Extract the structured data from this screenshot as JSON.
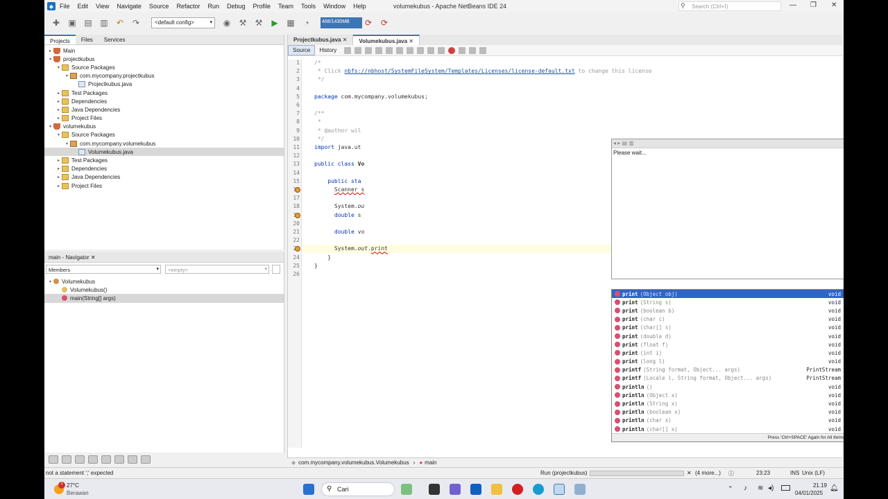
{
  "titlebar": {
    "title": "volumekubus - Apache NetBeans IDE 24",
    "search_placeholder": "Search (Ctrl+I)"
  },
  "menu": [
    "File",
    "Edit",
    "View",
    "Navigate",
    "Source",
    "Refactor",
    "Run",
    "Debug",
    "Profile",
    "Team",
    "Tools",
    "Window",
    "Help"
  ],
  "toolbar": {
    "config": "<default config>",
    "memory": "468/1430MB"
  },
  "projects": {
    "tabs": [
      "Projects",
      "Files",
      "Services"
    ],
    "tree": [
      {
        "label": "Main",
        "indent": 0,
        "icon": "cup",
        "toggle": "▸"
      },
      {
        "label": "projectkubus",
        "indent": 0,
        "icon": "cup",
        "toggle": "▾"
      },
      {
        "label": "Source Packages",
        "indent": 1,
        "icon": "fold",
        "toggle": "▾"
      },
      {
        "label": "com.mycompany.projectkubus",
        "indent": 2,
        "icon": "pkg",
        "toggle": "▾"
      },
      {
        "label": "Projectkubus.java",
        "indent": 3,
        "icon": "javaf",
        "toggle": ""
      },
      {
        "label": "Test Packages",
        "indent": 1,
        "icon": "fold",
        "toggle": "▸"
      },
      {
        "label": "Dependencies",
        "indent": 1,
        "icon": "fold",
        "toggle": "▸"
      },
      {
        "label": "Java Dependencies",
        "indent": 1,
        "icon": "fold",
        "toggle": "▸"
      },
      {
        "label": "Project Files",
        "indent": 1,
        "icon": "fold",
        "toggle": "▸"
      },
      {
        "label": "volumekubus",
        "indent": 0,
        "icon": "cup",
        "toggle": "▾"
      },
      {
        "label": "Source Packages",
        "indent": 1,
        "icon": "fold",
        "toggle": "▾"
      },
      {
        "label": "com.mycompany.volumekubus",
        "indent": 2,
        "icon": "pkg",
        "toggle": "▾"
      },
      {
        "label": "Volumekubus.java",
        "indent": 3,
        "icon": "javaf",
        "toggle": "",
        "selected": true
      },
      {
        "label": "Test Packages",
        "indent": 1,
        "icon": "fold",
        "toggle": "▸"
      },
      {
        "label": "Dependencies",
        "indent": 1,
        "icon": "fold",
        "toggle": "▸"
      },
      {
        "label": "Java Dependencies",
        "indent": 1,
        "icon": "fold",
        "toggle": "▸"
      },
      {
        "label": "Project Files",
        "indent": 1,
        "icon": "fold",
        "toggle": "▸"
      }
    ]
  },
  "navigator": {
    "title": "main - Navigator",
    "members": "Members",
    "empty": "<empty>",
    "tree": [
      {
        "label": "Volumekubus",
        "indent": 0,
        "toggle": "▾"
      },
      {
        "label": "Volumekubus()",
        "indent": 1,
        "toggle": ""
      },
      {
        "label": "main(String[] args)",
        "indent": 1,
        "toggle": "",
        "selected": true
      }
    ]
  },
  "editor": {
    "tabs": [
      "Projectkubus.java",
      "Volumekubus.java"
    ],
    "source": "Source",
    "history": "History",
    "lines": [
      {
        "n": "1",
        "html": "<span class='cmt'>/*</span>"
      },
      {
        "n": "2",
        "html": "<span class='cmt'> * Click </span><span class='lnk'>nbfs://nbhost/SystemFileSystem/Templates/Licenses/license-default.txt</span><span class='cmt'> to change this license</span>"
      },
      {
        "n": "3",
        "html": "<span class='cmt'> */</span>"
      },
      {
        "n": "4",
        "html": ""
      },
      {
        "n": "5",
        "html": "<span class='kw'>package</span> com.mycompany.volumekubus;"
      },
      {
        "n": "6",
        "html": ""
      },
      {
        "n": "7",
        "html": "<span class='cmt'>/**</span>"
      },
      {
        "n": "8",
        "html": "<span class='cmt'> *</span>"
      },
      {
        "n": "9",
        "html": "<span class='cmt'> * @author wil</span>"
      },
      {
        "n": "10",
        "html": "<span class='cmt'> */</span>"
      },
      {
        "n": "11",
        "html": "<span class='kw'>import</span> java.ut"
      },
      {
        "n": "12",
        "html": ""
      },
      {
        "n": "13",
        "html": "<span class='kw'>public class</span> <b>Vo</b>"
      },
      {
        "n": "14",
        "html": ""
      },
      {
        "n": "15",
        "html": "    <span class='kw'>public sta</span>"
      },
      {
        "n": "16",
        "html": "      <span style='text-decoration:underline wavy #d00'>Scanner s</span>"
      },
      {
        "n": "17",
        "html": ""
      },
      {
        "n": "18",
        "html": "      System.<i>ou</i>"
      },
      {
        "n": "19",
        "html": "      <span class='kw'>double</span> s"
      },
      {
        "n": "20",
        "html": ""
      },
      {
        "n": "21",
        "html": "      <span class='kw'>double</span> vo"
      },
      {
        "n": "22",
        "html": ""
      },
      {
        "n": "23",
        "html": "      System.<i>out</i>.<span style='text-decoration:underline wavy #d00'>print</span>",
        "current": true
      },
      {
        "n": "24",
        "html": "    }"
      },
      {
        "n": "25",
        "html": "}"
      },
      {
        "n": "26",
        "html": ""
      }
    ],
    "popup_text": "Please wait...",
    "completion": [
      {
        "name": "print",
        "params": "(Object obj)",
        "ret": "void"
      },
      {
        "name": "print",
        "params": "(String s)",
        "ret": "void"
      },
      {
        "name": "print",
        "params": "(boolean b)",
        "ret": "void"
      },
      {
        "name": "print",
        "params": "(char c)",
        "ret": "void"
      },
      {
        "name": "print",
        "params": "(char[] s)",
        "ret": "void"
      },
      {
        "name": "print",
        "params": "(double d)",
        "ret": "void"
      },
      {
        "name": "print",
        "params": "(float f)",
        "ret": "void"
      },
      {
        "name": "print",
        "params": "(int i)",
        "ret": "void"
      },
      {
        "name": "print",
        "params": "(long l)",
        "ret": "void"
      },
      {
        "name": "printf",
        "params": "(String format, Object... args)",
        "ret": "PrintStream"
      },
      {
        "name": "printf",
        "params": "(Locale l, String format, Object... args)",
        "ret": "PrintStream"
      },
      {
        "name": "println",
        "params": "()",
        "ret": "void"
      },
      {
        "name": "println",
        "params": "(Object x)",
        "ret": "void"
      },
      {
        "name": "println",
        "params": "(String x)",
        "ret": "void"
      },
      {
        "name": "println",
        "params": "(boolean x)",
        "ret": "void"
      },
      {
        "name": "println",
        "params": "(char x)",
        "ret": "void"
      },
      {
        "name": "println",
        "params": "(char[] x)",
        "ret": "void"
      }
    ],
    "completion_footer": "Press 'Ctrl+SPACE' Again for All Items"
  },
  "breadcrumb": {
    "cls": "com.mycompany.volumekubus.Volumekubus",
    "method": "main"
  },
  "status": {
    "left": "not a statement   ';' expected",
    "run": "Run (projectkubus)",
    "more": "(4 more...)",
    "pos": "23:23",
    "mode": "INS",
    "eol": "Unix (LF)"
  },
  "taskbar": {
    "temp": "27°C",
    "weather": "Berawan",
    "search": "Cari",
    "time": "21.19",
    "date": "04/01/2025",
    "badge": "1"
  }
}
